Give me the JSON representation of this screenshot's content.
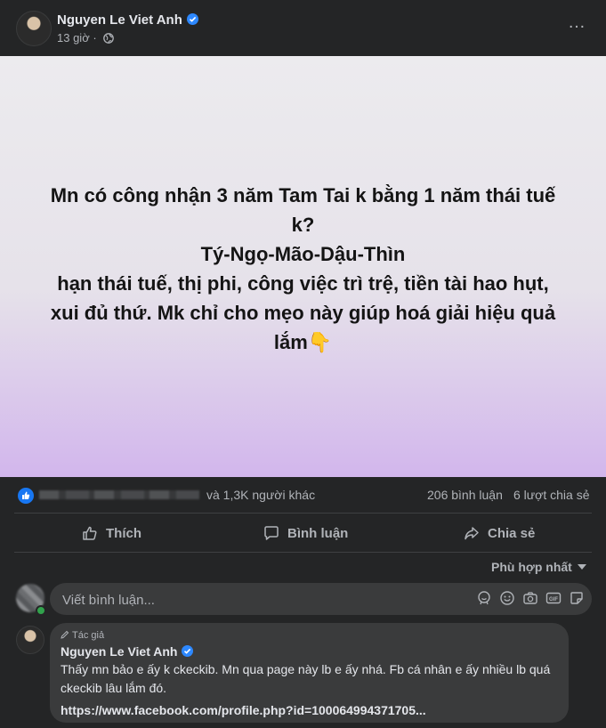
{
  "post": {
    "author": "Nguyen Le Viet Anh",
    "time": "13 giờ",
    "content_lines": [
      "Mn có công nhận 3 năm Tam Tai k bằng 1 năm thái tuế",
      "k?",
      "Tý-Ngọ-Mão-Dậu-Thìn",
      "hạn thái tuế, thị phi, công việc trì trệ, tiền tài hao hụt,",
      "xui đủ thứ. Mk chỉ cho mẹo này giúp hoá giải hiệu quả",
      "lắm👇"
    ],
    "reactions": "và 1,3K người khác",
    "comments_count": "206 bình luận",
    "shares_count": "6 lượt chia sẻ"
  },
  "actions": {
    "like": "Thích",
    "comment": "Bình luận",
    "share": "Chia sẻ"
  },
  "sort_label": "Phù hợp nhất",
  "composer": {
    "placeholder": "Viết bình luận..."
  },
  "comment": {
    "tag": "Tác giả",
    "author": "Nguyen Le Viet Anh",
    "text": "Thấy mn bảo e ấy k ckeckib. Mn qua page này lb e ấy nhá. Fb cá nhân e ấy nhiều lb quá ckeckib lâu lắm đó.",
    "link": "https://www.facebook.com/profile.php?id=100064994371705..."
  },
  "colors": {
    "background": "#242526",
    "verified_blue": "#2d88ff",
    "like_blue": "#1877f2"
  },
  "icons": [
    "verified-icon",
    "globe-icon",
    "more-icon",
    "like-reaction-icon",
    "thumbs-up-icon",
    "comment-icon",
    "share-icon",
    "sticker-icon",
    "emoji-icon",
    "camera-icon",
    "gif-icon",
    "avatar-sticker-icon",
    "pencil-icon"
  ]
}
